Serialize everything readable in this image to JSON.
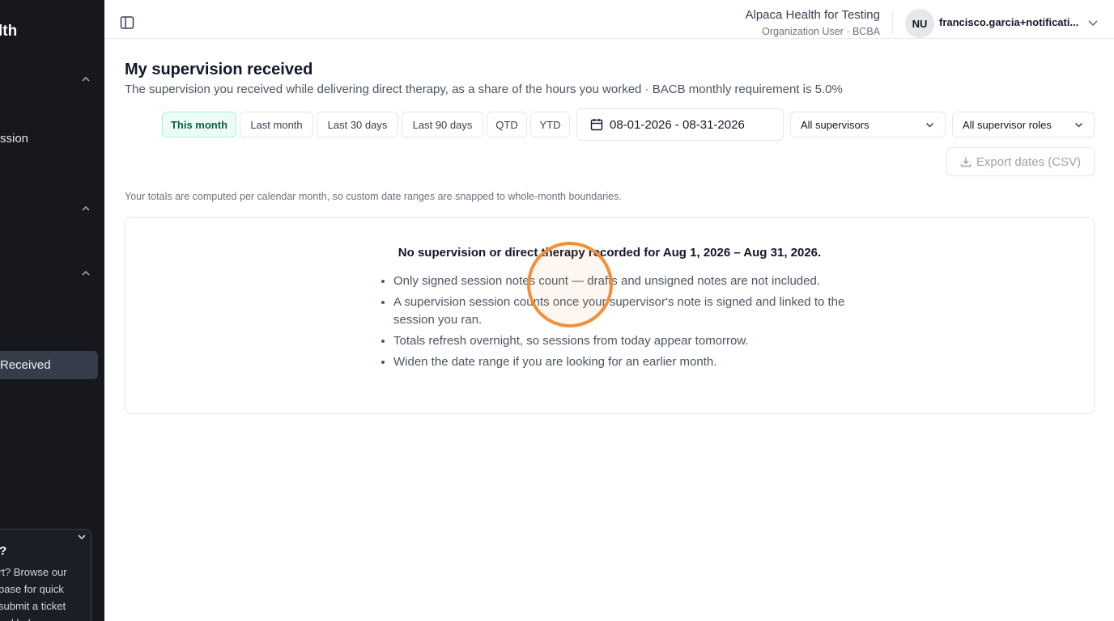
{
  "sidebar": {
    "brand": "lth",
    "items": [
      {
        "label": "ssion"
      },
      {
        "label": "Received"
      }
    ],
    "help": {
      "title": "?",
      "text": "rt? Browse our\nbase for quick\nsubmit a ticket\nred help"
    }
  },
  "header": {
    "org_name": "Alpaca Health for Testing",
    "org_role": "Organization User · BCBA",
    "avatar_initials": "NU",
    "user_name": "francisco.garcia+notificati..."
  },
  "main": {
    "title": "My supervision received",
    "subtitle": "The supervision you received while delivering direct therapy, as a share of the hours you worked · BACB monthly requirement is 5.0%",
    "range_chips": [
      "This month",
      "Last month",
      "Last 30 days",
      "Last 90 days",
      "QTD",
      "YTD"
    ],
    "active_chip": "This month",
    "date_range": "08-01-2026 - 08-31-2026",
    "supervisor_select": "All supervisors",
    "role_select": "All supervisor roles",
    "export_label": "Export dates (CSV)",
    "footnote": "Your totals are computed per calendar month, so custom date ranges are snapped to whole-month boundaries.",
    "empty_state": {
      "title": "No supervision or direct therapy recorded for Aug 1, 2026 – Aug 31, 2026.",
      "bullets": [
        "Only signed session notes count — drafts and unsigned notes are not included.",
        "A supervision session counts once your supervisor's note is signed and linked to the session you ran.",
        "Totals refresh overnight, so sessions from today appear tomorrow.",
        "Widen the date range if you are looking for an earlier month."
      ]
    }
  },
  "colors": {
    "sidebar_bg": "#16181d",
    "active_chip_bg": "#ecfdf5",
    "cursor_ring": "#f0913a"
  }
}
